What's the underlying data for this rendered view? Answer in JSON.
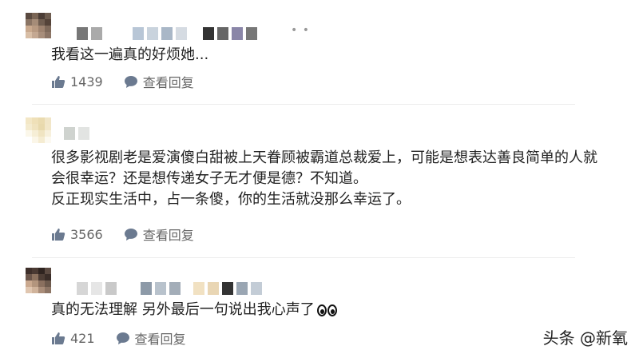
{
  "comments": [
    {
      "text_lines": [
        "我看这一遍真的好烦她..."
      ],
      "like_count": "1439",
      "reply_label": "查看回复",
      "more_icon": "more-icon"
    },
    {
      "text_lines": [
        "很多影视剧老是爱演傻白甜被上天眷顾被霸道总裁爱上，可能是想表达善良简单的人就",
        "会很幸运？还是想传递女子无才便是德？不知道。",
        "反正现实生活中，占一条傻，你的生活就没那么幸运了。"
      ],
      "like_count": "3566",
      "reply_label": "查看回复"
    },
    {
      "text_lines": [
        "真的无法理解 另外最后一句说出我心声了"
      ],
      "emoji": "eyes-emoji",
      "like_count": "421",
      "reply_label": "查看回复"
    }
  ],
  "watermark": {
    "text": "头条 @新氧"
  },
  "colors": {
    "text": "#222222",
    "meta": "#666666",
    "divider": "#ececec"
  }
}
